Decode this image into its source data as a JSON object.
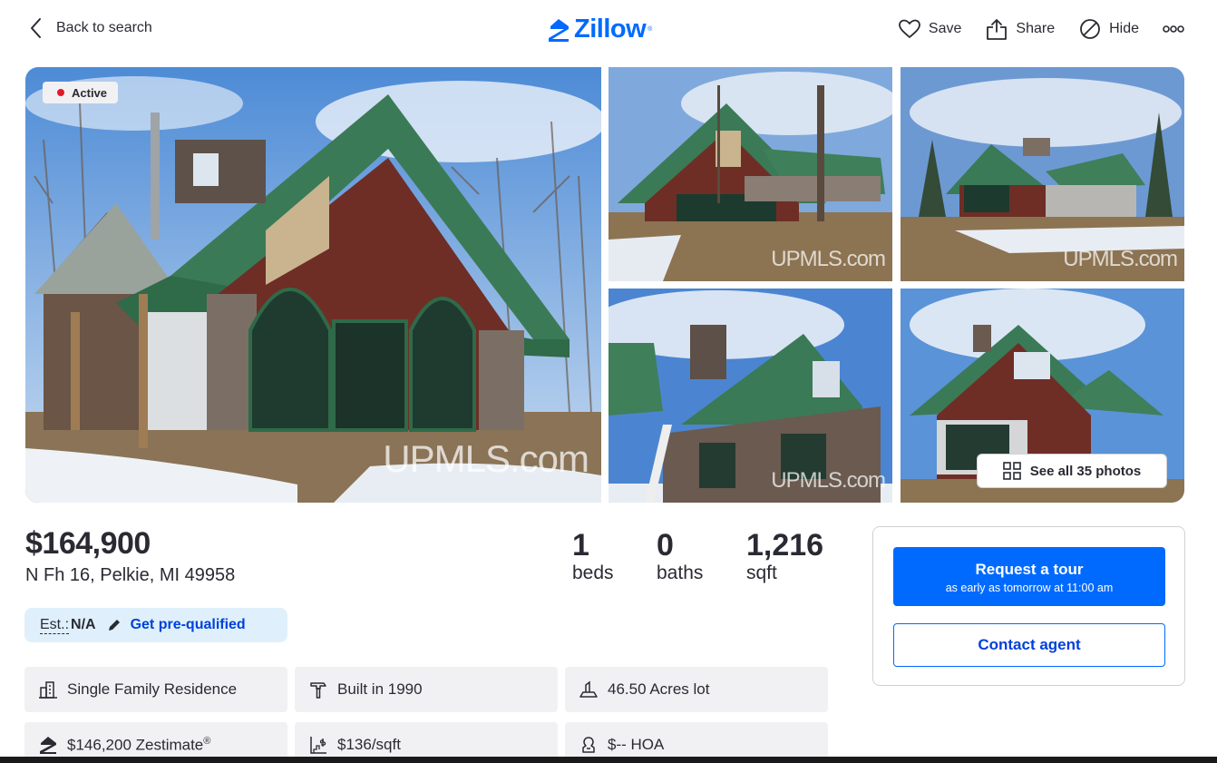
{
  "header": {
    "back_label": "Back to search",
    "logo_text": "Zillow",
    "logo_mark": "®",
    "actions": {
      "save": "Save",
      "share": "Share",
      "hide": "Hide"
    },
    "more_icon": "more-dots-icon"
  },
  "gallery": {
    "status_badge": "Active",
    "watermark": "UPMLS.com",
    "see_all_label": "See all 35 photos"
  },
  "listing": {
    "price": "$164,900",
    "address": "N Fh 16, Pelkie, MI 49958",
    "beds": {
      "value": "1",
      "label": "beds"
    },
    "baths": {
      "value": "0",
      "label": "baths"
    },
    "sqft": {
      "value": "1,216",
      "label": "sqft"
    },
    "estimate": {
      "label": "Est.:",
      "value": "N/A",
      "link": "Get pre-qualified"
    },
    "facts": {
      "type": "Single Family Residence",
      "built": "Built in 1990",
      "lot": "46.50 Acres lot",
      "zestimate": "$146,200 Zestimate",
      "zestimate_mark": "®",
      "price_per_sqft": "$136/sqft",
      "hoa": "$-- HOA"
    }
  },
  "contact": {
    "tour_title": "Request a tour",
    "tour_subtitle": "as early as tomorrow at 11:00 am",
    "contact_agent": "Contact agent"
  },
  "colors": {
    "brand_blue": "#006aff",
    "link_blue": "#0041d9",
    "active_red": "#e0192b",
    "estimate_bg": "#dff0fc",
    "fact_bg": "#f1f1f4",
    "text": "#2a2a33"
  }
}
